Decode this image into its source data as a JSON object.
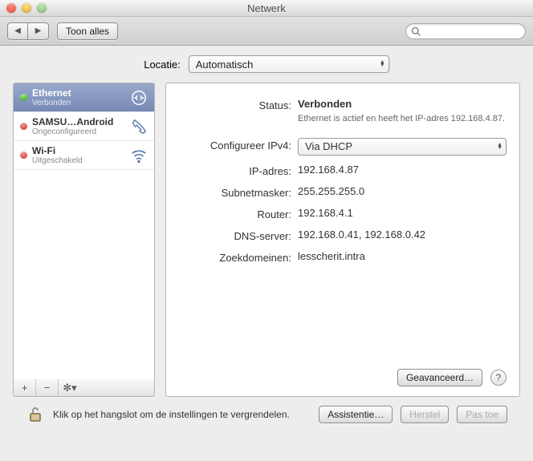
{
  "window": {
    "title": "Netwerk"
  },
  "toolbar": {
    "showAll": "Toon alles",
    "searchPlaceholder": ""
  },
  "location": {
    "label": "Locatie:",
    "value": "Automatisch"
  },
  "sidebar": {
    "items": [
      {
        "name": "Ethernet",
        "status": "Verbonden",
        "dot": "green"
      },
      {
        "name": "SAMSU…Android",
        "status": "Ongeconfigureerd",
        "dot": "red"
      },
      {
        "name": "Wi-Fi",
        "status": "Uitgeschakeld",
        "dot": "red"
      }
    ]
  },
  "detail": {
    "statusLabel": "Status:",
    "statusValue": "Verbonden",
    "statusDesc": "Ethernet is actief en heeft het IP-adres 192.168.4.87.",
    "ipv4Label": "Configureer IPv4:",
    "ipv4Value": "Via DHCP",
    "ipLabel": "IP-adres:",
    "ipValue": "192.168.4.87",
    "maskLabel": "Subnetmasker:",
    "maskValue": "255.255.255.0",
    "routerLabel": "Router:",
    "routerValue": "192.168.4.1",
    "dnsLabel": "DNS-server:",
    "dnsValue": "192.168.0.41, 192.168.0.42",
    "searchLabel": "Zoekdomeinen:",
    "searchValue": "lesscherit.intra",
    "advanced": "Geavanceerd…"
  },
  "footer": {
    "lockMsg": "Klik op het hangslot om de instellingen te vergrendelen.",
    "assist": "Assistentie…",
    "revert": "Herstel",
    "apply": "Pas toe"
  }
}
